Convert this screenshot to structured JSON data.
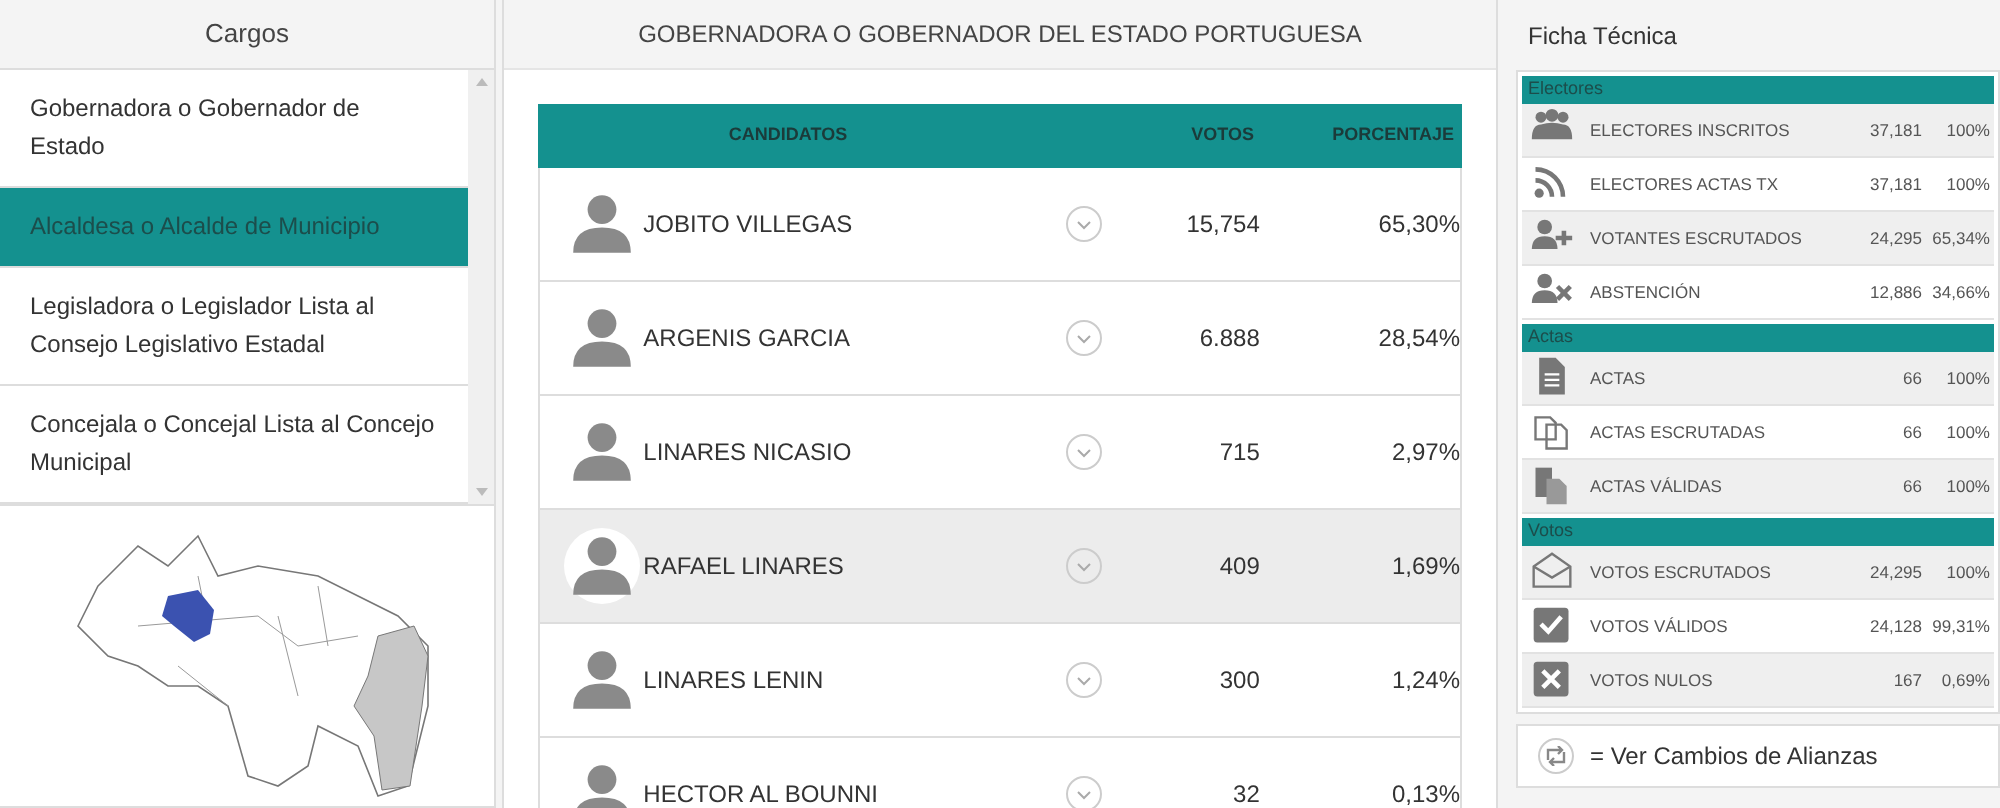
{
  "cargos": {
    "title": "Cargos",
    "items": [
      {
        "label": "Gobernadora o Gobernador de Estado",
        "selected": false
      },
      {
        "label": "Alcaldesa o Alcalde de Municipio",
        "selected": true
      },
      {
        "label": "Legisladora o Legislador Lista al Consejo Legislativo Estadal",
        "selected": false
      },
      {
        "label": "Concejala o Concejal Lista al Concejo Municipal",
        "selected": false
      }
    ]
  },
  "results": {
    "title": "GOBERNADORA O GOBERNADOR DEL ESTADO PORTUGUESA",
    "columns": [
      "CANDIDATOS",
      "VOTOS",
      "PORCENTAJE"
    ],
    "rows": [
      {
        "name": "JOBITO VILLEGAS",
        "votes": "15,754",
        "percent": "65,30%",
        "selected": false
      },
      {
        "name": "ARGENIS GARCIA",
        "votes": "6.888",
        "percent": "28,54%",
        "selected": false
      },
      {
        "name": "LINARES NICASIO",
        "votes": "715",
        "percent": "2,97%",
        "selected": false
      },
      {
        "name": "RAFAEL LINARES",
        "votes": "409",
        "percent": "1,69%",
        "selected": true
      },
      {
        "name": "LINARES LENIN",
        "votes": "300",
        "percent": "1,24%",
        "selected": false
      },
      {
        "name": "HECTOR AL BOUNNI",
        "votes": "32",
        "percent": "0,13%",
        "selected": false
      }
    ]
  },
  "ficha": {
    "title": "Ficha Técnica",
    "sections": [
      {
        "title": "Electores",
        "rows": [
          {
            "kind": "users",
            "label": "ELECTORES INSCRITOS",
            "value": "37,181",
            "percent": "100%"
          },
          {
            "kind": "feed",
            "label": "ELECTORES ACTAS TX",
            "value": "37,181",
            "percent": "100%"
          },
          {
            "kind": "user-plus",
            "label": "VOTANTES ESCRUTADOS",
            "value": "24,295",
            "percent": "65,34%"
          },
          {
            "kind": "user-x",
            "label": "ABSTENCIÓN",
            "value": "12,886",
            "percent": "34,66%"
          }
        ]
      },
      {
        "title": "Actas",
        "rows": [
          {
            "kind": "file",
            "label": "ACTAS",
            "value": "66",
            "percent": "100%"
          },
          {
            "kind": "copy",
            "label": "ACTAS ESCRUTADAS",
            "value": "66",
            "percent": "100%"
          },
          {
            "kind": "files",
            "label": "ACTAS VÁLIDAS",
            "value": "66",
            "percent": "100%"
          }
        ]
      },
      {
        "title": "Votos",
        "rows": [
          {
            "kind": "envelope",
            "label": "VOTOS ESCRUTADOS",
            "value": "24,295",
            "percent": "100%"
          },
          {
            "kind": "check",
            "label": "VOTOS VÁLIDOS",
            "value": "24,128",
            "percent": "99,31%"
          },
          {
            "kind": "cross",
            "label": "VOTOS NULOS",
            "value": "167",
            "percent": "0,69%"
          }
        ]
      }
    ]
  },
  "alliances_link": "= Ver Cambios de Alianzas"
}
